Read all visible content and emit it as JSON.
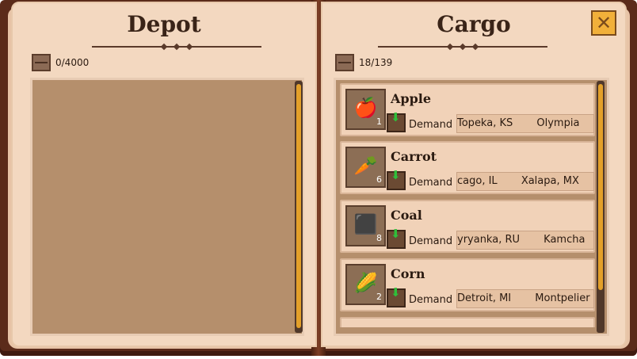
{
  "depot": {
    "title": "Depot",
    "capacity": "0/4000"
  },
  "cargo": {
    "title": "Cargo",
    "capacity": "18/139",
    "demand_label": "Demand",
    "items": [
      {
        "name": "Apple",
        "quantity": "1",
        "icon": "apple-icon",
        "glyph": "🍎",
        "destinations": [
          "Topeka, KS",
          "Olympia"
        ]
      },
      {
        "name": "Carrot",
        "quantity": "6",
        "icon": "carrot-icon",
        "glyph": "🥕",
        "destinations": [
          "cago, IL",
          "Xalapa, MX"
        ]
      },
      {
        "name": "Coal",
        "quantity": "8",
        "icon": "coal-icon",
        "glyph": "⬛",
        "destinations": [
          "yryanka, RU",
          "Kamcha"
        ]
      },
      {
        "name": "Corn",
        "quantity": "2",
        "icon": "corn-icon",
        "glyph": "🌽",
        "destinations": [
          "Detroit, MI",
          "Montpelier"
        ]
      }
    ]
  },
  "close": {
    "icon": "close-icon",
    "glyph": "✕"
  }
}
